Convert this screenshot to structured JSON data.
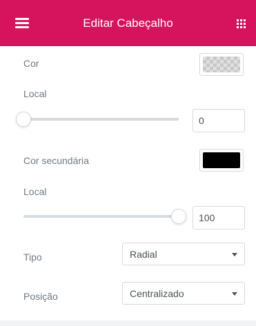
{
  "header": {
    "title": "Editar Cabeçalho",
    "menu_icon": "hamburger-menu-icon",
    "apps_icon": "grid-apps-icon",
    "background_color": "#d6145d"
  },
  "color": {
    "label": "Cor",
    "value": "transparent"
  },
  "location": {
    "label": "Local",
    "value": "0",
    "slider_fraction": 0
  },
  "second_color": {
    "label": "Cor secundária",
    "value": "#000000"
  },
  "second_location": {
    "label": "Local",
    "value": "100",
    "slider_fraction": 1
  },
  "type": {
    "label": "Tipo",
    "selected": "Radial"
  },
  "position": {
    "label": "Posição",
    "selected": "Centralizado"
  }
}
